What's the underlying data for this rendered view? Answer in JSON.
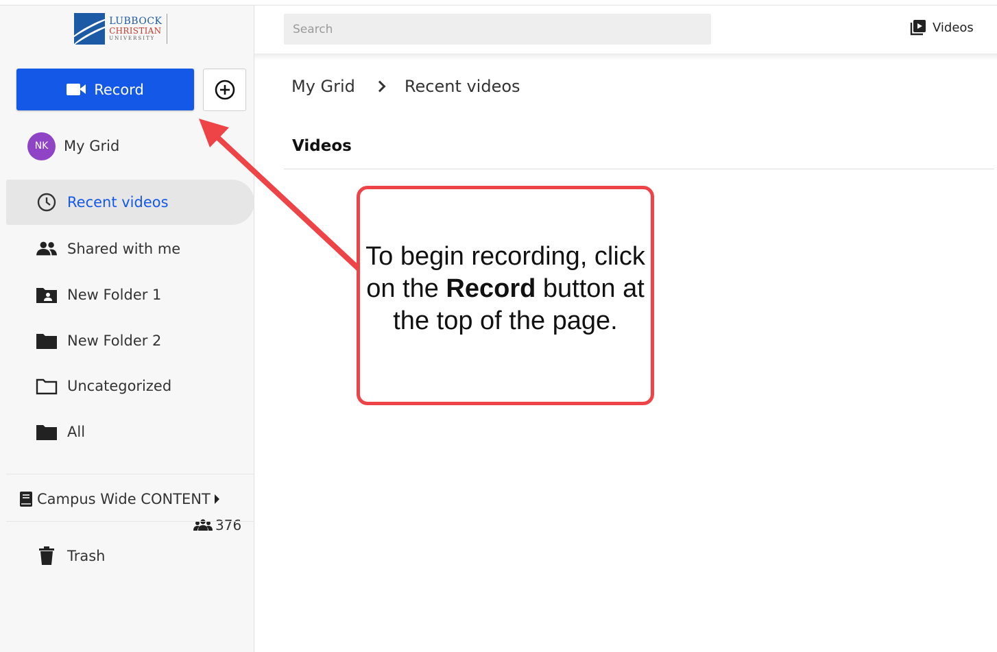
{
  "branding": {
    "logo_line1": "LUBBOCK",
    "logo_line2": "CHRISTIAN",
    "logo_line3": "UNIVERSITY",
    "logo_color": "#1c5aa6"
  },
  "sidebar": {
    "record_label": "Record",
    "add_icon": "plus-circle-icon",
    "user": {
      "initials": "NK",
      "label": "My Grid",
      "avatar_color": "#8e44c4"
    },
    "items": [
      {
        "label": "Recent videos",
        "icon": "clock-icon",
        "active": true
      },
      {
        "label": "Shared with me",
        "icon": "people-icon"
      },
      {
        "label": "New Folder 1",
        "icon": "shared-folder-icon"
      },
      {
        "label": "New Folder 2",
        "icon": "folder-icon"
      },
      {
        "label": "Uncategorized",
        "icon": "folder-outline-icon"
      },
      {
        "label": "All",
        "icon": "folder-icon"
      }
    ],
    "group": {
      "label": "Campus Wide CONTENT",
      "icon": "book-icon",
      "member_count": "376"
    },
    "trash_label": "Trash"
  },
  "header": {
    "search_placeholder": "Search",
    "videos_label": "Videos"
  },
  "main": {
    "breadcrumb": [
      "My Grid",
      "Recent videos"
    ],
    "section_title": "Videos"
  },
  "annotation": {
    "text_before": "To begin recording, click on the ",
    "text_bold": "Record",
    "text_after": " button at the top of the page.",
    "color": "#ee4347"
  },
  "colors": {
    "accent": "#1458e8",
    "active_bg": "#e6e6e6"
  }
}
